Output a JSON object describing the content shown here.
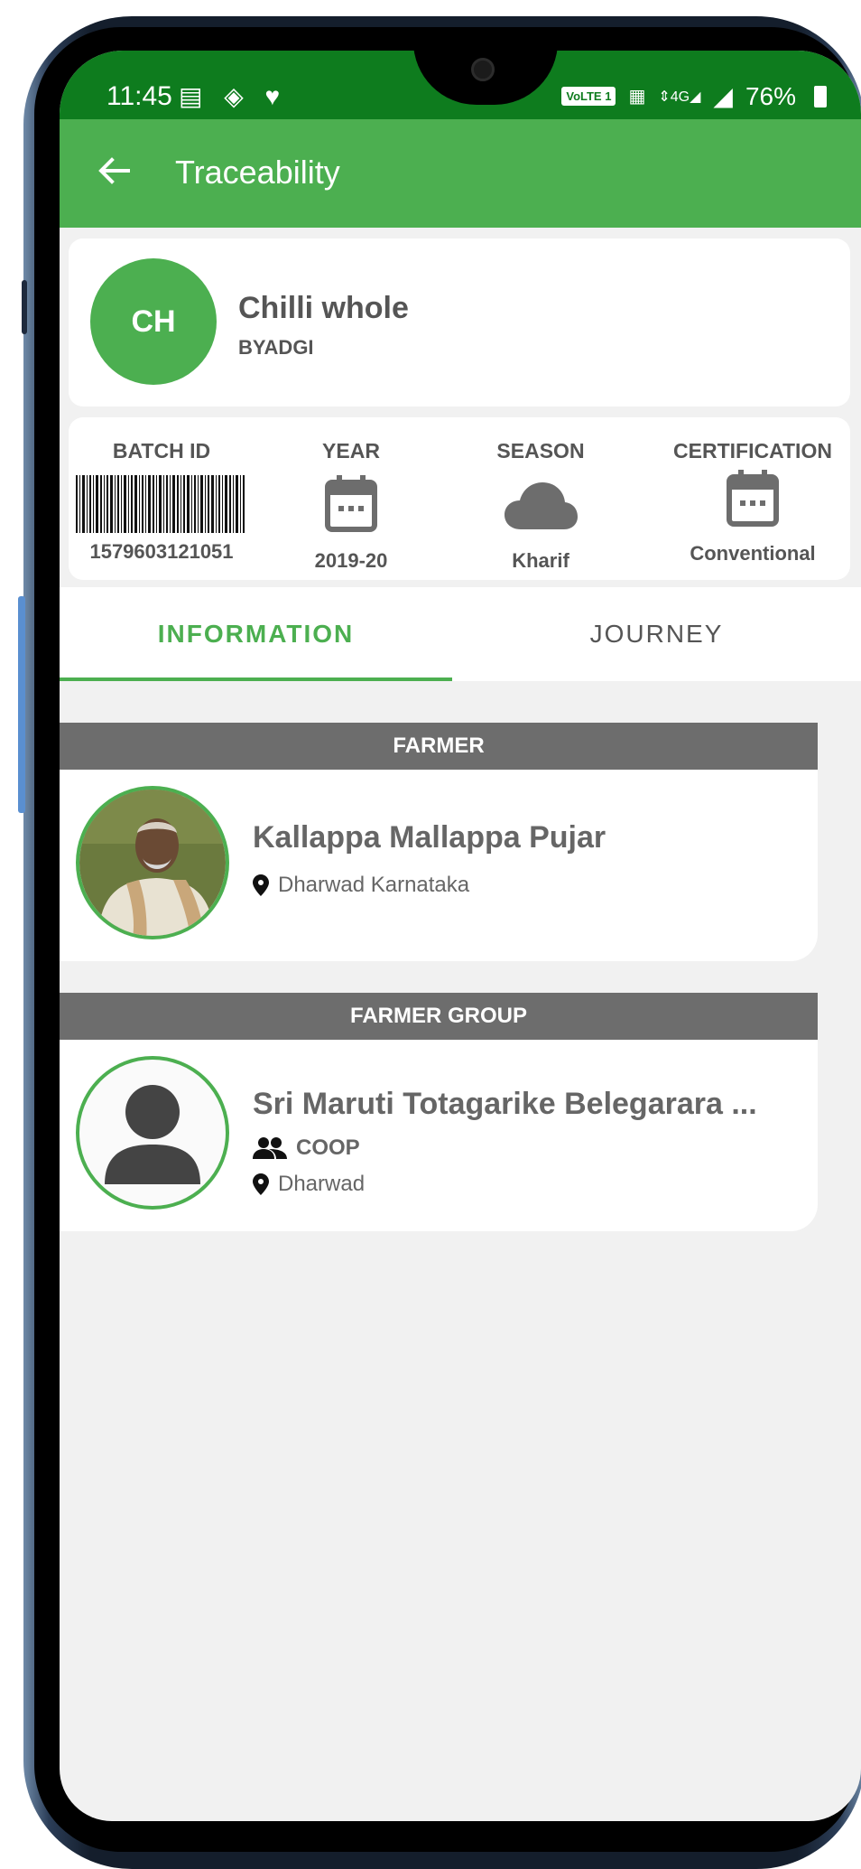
{
  "status_bar": {
    "time": "11:45",
    "network": "VoLTE 1",
    "signal": "4G",
    "battery": "76%"
  },
  "app_bar": {
    "title": "Traceability",
    "back_icon": "arrow-left-icon"
  },
  "product": {
    "initials": "CH",
    "name": "Chilli whole",
    "variety": "BYADGI"
  },
  "info": [
    {
      "label": "BATCH ID",
      "value": "1579603121051",
      "icon": "barcode-icon"
    },
    {
      "label": "YEAR",
      "value": "2019-20",
      "icon": "calendar-icon"
    },
    {
      "label": "SEASON",
      "value": "Kharif",
      "icon": "cloud-icon"
    },
    {
      "label": "CERTIFICATION",
      "value": "Conventional",
      "icon": "calendar-icon"
    }
  ],
  "tabs": [
    {
      "label": "INFORMATION",
      "active": true
    },
    {
      "label": "JOURNEY",
      "active": false
    }
  ],
  "farmer": {
    "header": "FARMER",
    "name": "Kallappa Mallappa Pujar",
    "location": "Dharwad Karnataka"
  },
  "farmer_group": {
    "header": "FARMER GROUP",
    "name": "Sri Maruti Totagarike Belegarara ...",
    "type": "COOP",
    "location": "Dharwad"
  },
  "colors": {
    "status_bar": "#0e7c1e",
    "app_bar": "#4caf50",
    "accent": "#4caf50",
    "section_header": "#6d6d6d",
    "background": "#f1f1f1"
  }
}
